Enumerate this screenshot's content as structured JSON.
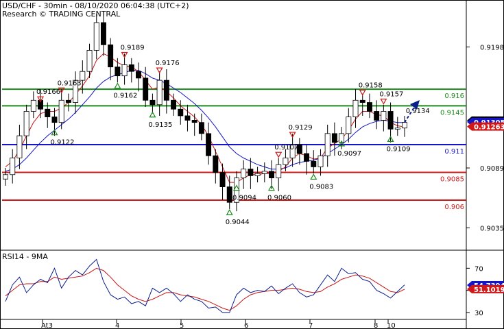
{
  "header": {
    "title": "USD/CHF - 30min - 08/10/2020 06:04:38 (UTC+2)",
    "research": "Research © TRADING CENTRAL"
  },
  "chart_data": [
    {
      "type": "candlestick",
      "title": "USD/CHF - 30min - 08/10/2020 06:04:38 (UTC+2)",
      "ylim": [
        0.9018,
        0.9228
      ],
      "yticks": [
        0.9198,
        0.9089,
        0.9035
      ],
      "x_day_labels": [
        "At3",
        "4",
        "5",
        "6",
        "7",
        "8",
        "10"
      ],
      "levels": [
        {
          "label": "0.916",
          "value": 0.916,
          "color": "#1a8a1a"
        },
        {
          "label": "0.9145",
          "value": 0.9145,
          "color": "#1a8a1a"
        },
        {
          "label": "0.911",
          "value": 0.911,
          "color": "#1414c8"
        },
        {
          "label": "0.9085",
          "value": 0.9085,
          "color": "#d01818"
        },
        {
          "label": "0.906",
          "value": 0.906,
          "color": "#d01818"
        }
      ],
      "price_tags": [
        {
          "label": "0.91317",
          "value": 0.91317,
          "color": "#000000"
        },
        {
          "label": "0.91305",
          "value": 0.91305,
          "color": "#1414c8"
        },
        {
          "label": "0.91263",
          "value": 0.91263,
          "color": "#d01818"
        }
      ],
      "pivot_annotations": [
        {
          "label": "0.9166",
          "kind": "high",
          "idx": 5
        },
        {
          "label": "0.9163",
          "kind": "high",
          "idx": 8
        },
        {
          "label": "0.9122",
          "kind": "low",
          "idx": 7
        },
        {
          "label": "0.9189",
          "kind": "high",
          "idx": 17
        },
        {
          "label": "0.9162",
          "kind": "low",
          "idx": 16
        },
        {
          "label": "0.9176",
          "kind": "high",
          "idx": 22
        },
        {
          "label": "0.9135",
          "kind": "low",
          "idx": 21
        },
        {
          "label": "0.9094",
          "kind": "low",
          "idx": 33
        },
        {
          "label": "0.9044",
          "kind": "low",
          "idx": 32
        },
        {
          "label": "0.9107",
          "kind": "high",
          "idx": 39
        },
        {
          "label": "0.9060",
          "kind": "low",
          "idx": 38
        },
        {
          "label": "0.9129",
          "kind": "high",
          "idx": 41
        },
        {
          "label": "0.9083",
          "kind": "low",
          "idx": 44
        },
        {
          "label": "0.9097",
          "kind": "low",
          "idx": 48
        },
        {
          "label": "0.9158",
          "kind": "high",
          "idx": 51
        },
        {
          "label": "0.9157",
          "kind": "high",
          "idx": 54
        },
        {
          "label": "0.9109",
          "kind": "low",
          "idx": 55
        },
        {
          "label": "0.9134",
          "kind": "label",
          "idx": 56
        }
      ],
      "series_price": {
        "x": [
          0,
          1,
          2,
          3,
          4,
          5,
          6,
          7,
          8,
          9,
          10,
          11,
          12,
          13,
          14,
          15,
          16,
          17,
          18,
          19,
          20,
          21,
          22,
          23,
          24,
          25,
          26,
          27,
          28,
          29,
          30,
          31,
          32,
          33,
          34,
          35,
          36,
          37,
          38,
          39,
          40,
          41,
          42,
          43,
          44,
          45,
          46,
          47,
          48,
          49,
          50,
          51,
          52,
          53,
          54,
          55,
          56,
          57
        ],
        "close": [
          0.9083,
          0.9098,
          0.9118,
          0.914,
          0.915,
          0.9142,
          0.9135,
          0.913,
          0.915,
          0.9148,
          0.9168,
          0.9176,
          0.9195,
          0.922,
          0.92,
          0.918,
          0.9172,
          0.9182,
          0.9176,
          0.917,
          0.915,
          0.9146,
          0.9168,
          0.915,
          0.9142,
          0.9136,
          0.9132,
          0.913,
          0.912,
          0.91,
          0.9085,
          0.9072,
          0.9058,
          0.908,
          0.9088,
          0.9082,
          0.9084,
          0.9086,
          0.908,
          0.9092,
          0.9098,
          0.911,
          0.9102,
          0.9095,
          0.909,
          0.91,
          0.912,
          0.9112,
          0.912,
          0.9135,
          0.915,
          0.9148,
          0.914,
          0.9132,
          0.914,
          0.9124,
          0.9125,
          0.913
        ]
      },
      "series_ma_fast": [
        0.909,
        0.9095,
        0.9105,
        0.9118,
        0.913,
        0.9138,
        0.914,
        0.914,
        0.9143,
        0.9148,
        0.9155,
        0.9163,
        0.9172,
        0.9186,
        0.9192,
        0.9189,
        0.9184,
        0.9181,
        0.918,
        0.9176,
        0.9168,
        0.916,
        0.9162,
        0.9158,
        0.9152,
        0.9145,
        0.914,
        0.9135,
        0.9128,
        0.9118,
        0.9104,
        0.909,
        0.9076,
        0.9076,
        0.908,
        0.9083,
        0.9083,
        0.9084,
        0.9084,
        0.9086,
        0.909,
        0.9098,
        0.9102,
        0.91,
        0.9097,
        0.9098,
        0.9107,
        0.9111,
        0.9115,
        0.9123,
        0.9133,
        0.914,
        0.914,
        0.9137,
        0.9136,
        0.913,
        0.9127,
        0.9126
      ],
      "series_ma_slow": [
        0.9086,
        0.9088,
        0.9092,
        0.9098,
        0.9105,
        0.9112,
        0.9118,
        0.9123,
        0.9128,
        0.9133,
        0.9139,
        0.9146,
        0.9153,
        0.9161,
        0.9167,
        0.9171,
        0.9173,
        0.9175,
        0.9177,
        0.9177,
        0.9174,
        0.917,
        0.9168,
        0.9165,
        0.9161,
        0.9157,
        0.9152,
        0.9147,
        0.9141,
        0.9134,
        0.9126,
        0.9117,
        0.9108,
        0.9102,
        0.9098,
        0.9095,
        0.9092,
        0.909,
        0.9088,
        0.9088,
        0.9089,
        0.9092,
        0.9094,
        0.9095,
        0.9096,
        0.9098,
        0.9102,
        0.9106,
        0.911,
        0.9115,
        0.9121,
        0.9126,
        0.9129,
        0.9131,
        0.9132,
        0.9131,
        0.913,
        0.913
      ]
    },
    {
      "type": "line",
      "title": "RSI14 - 9MA",
      "ylim": [
        25,
        82
      ],
      "yticks": [
        70,
        50,
        30
      ],
      "rsi_tags": [
        {
          "label": "54.7394",
          "value": 54.74,
          "color": "#1414c8"
        },
        {
          "label": "51.1019",
          "value": 51.1,
          "color": "#d01818"
        }
      ],
      "rsi": [
        40,
        55,
        62,
        48,
        55,
        60,
        57,
        70,
        52,
        62,
        68,
        64,
        72,
        78,
        58,
        46,
        42,
        44,
        38,
        40,
        36,
        52,
        48,
        52,
        47,
        40,
        46,
        42,
        40,
        34,
        35,
        30,
        30,
        46,
        52,
        48,
        50,
        49,
        54,
        47,
        52,
        56,
        48,
        44,
        46,
        55,
        64,
        58,
        70,
        65,
        66,
        60,
        58,
        50,
        47,
        43,
        49,
        55
      ],
      "rsi_ma": [
        45,
        50,
        55,
        56,
        56,
        58,
        58,
        62,
        60,
        61,
        62,
        63,
        66,
        70,
        68,
        62,
        55,
        50,
        45,
        42,
        40,
        42,
        45,
        48,
        48,
        46,
        45,
        44,
        42,
        40,
        37,
        34,
        32,
        36,
        42,
        46,
        48,
        49,
        50,
        50,
        51,
        52,
        51,
        49,
        48,
        49,
        53,
        56,
        60,
        62,
        64,
        63,
        61,
        57,
        53,
        49,
        48,
        51
      ]
    }
  ]
}
